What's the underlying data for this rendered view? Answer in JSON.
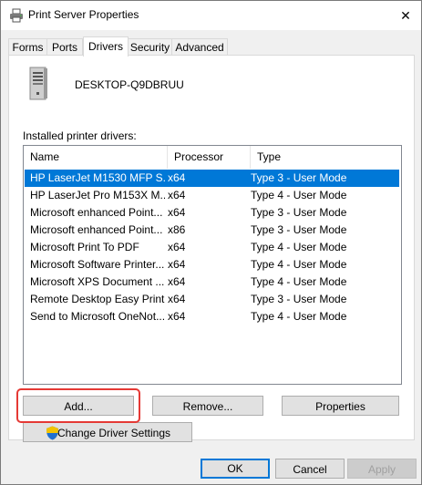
{
  "window": {
    "title": "Print Server Properties",
    "close_glyph": "✕"
  },
  "tabs": [
    {
      "label": "Forms",
      "active": false
    },
    {
      "label": "Ports",
      "active": false
    },
    {
      "label": "Drivers",
      "active": true
    },
    {
      "label": "Security",
      "active": false
    },
    {
      "label": "Advanced",
      "active": false
    }
  ],
  "server": {
    "name": "DESKTOP-Q9DBRUU",
    "icon": "computer-tower-icon"
  },
  "installed_label": "Installed printer drivers:",
  "table": {
    "columns": [
      "Name",
      "Processor",
      "Type"
    ],
    "rows": [
      {
        "name": "HP LaserJet M1530 MFP S...",
        "processor": "x64",
        "type": "Type 3 - User Mode",
        "selected": true
      },
      {
        "name": "HP LaserJet Pro M153X M...",
        "processor": "x64",
        "type": "Type 4 - User Mode",
        "selected": false
      },
      {
        "name": "Microsoft enhanced Point...",
        "processor": "x64",
        "type": "Type 3 - User Mode",
        "selected": false
      },
      {
        "name": "Microsoft enhanced Point...",
        "processor": "x86",
        "type": "Type 3 - User Mode",
        "selected": false
      },
      {
        "name": "Microsoft Print To PDF",
        "processor": "x64",
        "type": "Type 4 - User Mode",
        "selected": false
      },
      {
        "name": "Microsoft Software Printer...",
        "processor": "x64",
        "type": "Type 4 - User Mode",
        "selected": false
      },
      {
        "name": "Microsoft XPS Document ...",
        "processor": "x64",
        "type": "Type 4 - User Mode",
        "selected": false
      },
      {
        "name": "Remote Desktop Easy Print",
        "processor": "x64",
        "type": "Type 3 - User Mode",
        "selected": false
      },
      {
        "name": "Send to Microsoft OneNot...",
        "processor": "x64",
        "type": "Type 4 - User Mode",
        "selected": false
      }
    ]
  },
  "buttons": {
    "add": "Add...",
    "remove": "Remove...",
    "properties": "Properties",
    "change_driver_settings": "Change Driver Settings",
    "ok": "OK",
    "cancel": "Cancel",
    "apply": "Apply"
  },
  "colors": {
    "selection": "#0078d7",
    "highlight": "#e53935"
  }
}
